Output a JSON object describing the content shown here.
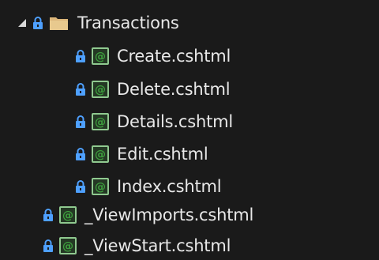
{
  "explorer": {
    "folder": {
      "label": "Transactions",
      "expanded": true,
      "icon": "folder-icon",
      "status_icon": "lock-icon"
    },
    "children": [
      {
        "label": "Create.cshtml",
        "icon": "razor-file-icon",
        "status_icon": "lock-icon"
      },
      {
        "label": "Delete.cshtml",
        "icon": "razor-file-icon",
        "status_icon": "lock-icon"
      },
      {
        "label": "Details.cshtml",
        "icon": "razor-file-icon",
        "status_icon": "lock-icon"
      },
      {
        "label": "Edit.cshtml",
        "icon": "razor-file-icon",
        "status_icon": "lock-icon"
      },
      {
        "label": "Index.cshtml",
        "icon": "razor-file-icon",
        "status_icon": "lock-icon"
      }
    ],
    "siblings": [
      {
        "label": "_ViewImports.cshtml",
        "icon": "razor-file-icon",
        "status_icon": "lock-icon"
      },
      {
        "label": "_ViewStart.cshtml",
        "icon": "razor-file-icon",
        "status_icon": "lock-icon"
      }
    ]
  },
  "colors": {
    "background": "#1a1a1a",
    "text": "#e8e8e8",
    "lock": "#4ea0ff",
    "folder": "#dcb67a",
    "razor_frame": "#8fc98f",
    "razor_at": "#3ea03e"
  }
}
